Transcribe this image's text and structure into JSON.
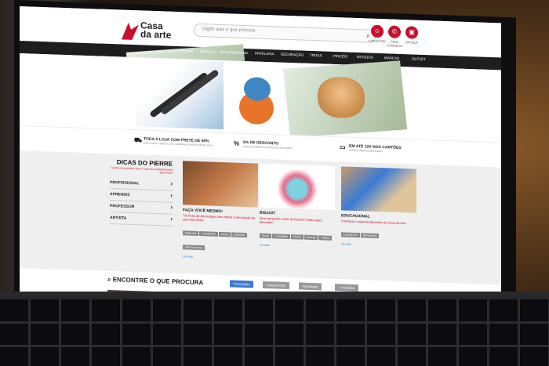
{
  "header": {
    "logo_line1": "Casa",
    "logo_line2": "da arte",
    "search_placeholder": "Digite aqui o que procura",
    "icons": [
      {
        "name": "user-icon",
        "label": "CADASTRE"
      },
      {
        "name": "phone-icon",
        "label": "FALE CONOSCO"
      },
      {
        "name": "bag-icon",
        "label": "SACOLA"
      }
    ]
  },
  "nav": {
    "categories_label": "VEJA TODAS AS CATEGORIAS",
    "items": [
      "DESENHO",
      "BASICAS",
      "SCRAPBOOKING",
      "PAPELARIA",
      "DECORAÇÃO",
      "TINTAS",
      "PINCÉIS",
      "ESTOJOS",
      "MARCAS",
      "OUTLET"
    ]
  },
  "features": [
    {
      "title": "TODA A LOJA COM FRETE DE 50%",
      "sub": "PARA TODO O BRASIL NAS COMPRAS A PARTIR DE R$ 100,00"
    },
    {
      "title": "5% DE DESCONTO",
      "sub": "PARA PAGAMENTO NO BOLETO BANCÁRIO"
    },
    {
      "title": "EM ATÉ 12X NOS CARTÕES",
      "sub": "PARCELAMENTO SEM JUROS"
    }
  ],
  "dicas": {
    "title": "DICAS DO PIERRE",
    "subtitle": "Confira os produtos que a Casa do Artesprimavera para você!",
    "links": [
      "PROFISSIONAL",
      "APRENDIZ",
      "PROFESSOR",
      "ARTISTA"
    ]
  },
  "cards": [
    {
      "title": "FAÇA VOCÊ MESMO!",
      "desc": "Técnicas de decoupage para deixar a decoração da sua mais linda!",
      "tags": [
        "Materiais",
        "Livros/DVD",
        "Dicas",
        "Coleções",
        "Arte Francesa"
      ],
      "link": "ver tudo"
    },
    {
      "title": "BISCUIT",
      "desc": "Quer aprender a Arte do Biscuit? Clique para descobrir!",
      "tags": [
        "Dicas",
        "+ Vendidos",
        "Peças",
        "Marcas",
        "Vídeos"
      ],
      "link": "ver tudo"
    },
    {
      "title": "EDUCACIONAL",
      "desc": "Conheça o material educativo da Casa da Arte",
      "tags": [
        "Livros/DVD",
        "Brinquedos"
      ],
      "link": "ver tudo"
    }
  ],
  "find": {
    "title": "ENCONTRE O QUE PROCURA",
    "chips": [
      "Promoções",
      "Lançamentos",
      "Novidades",
      "+ Vendidos"
    ]
  },
  "colors": {
    "accent": "#c8102e",
    "nav": "#1e1e1e",
    "chip_active": "#3a7bd5"
  }
}
